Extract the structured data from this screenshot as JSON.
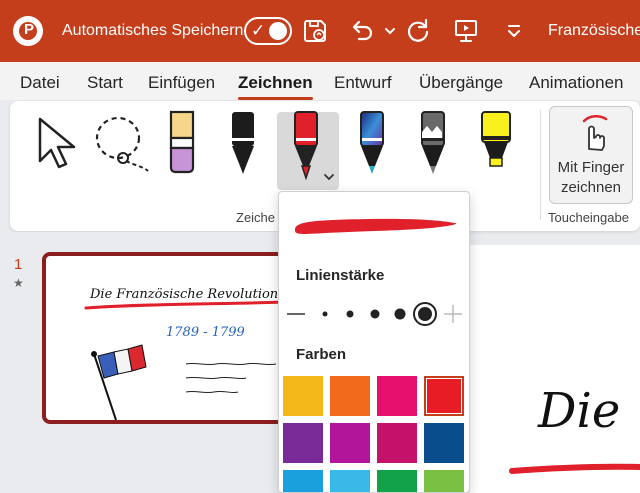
{
  "titlebar": {
    "app_logo_letter": "P",
    "autosave_label": "Automatisches Speichern",
    "autosave_on": true,
    "autosave_check": "✓",
    "document_title": "Französische",
    "icons": [
      "save-sync-icon",
      "undo-icon",
      "chevron-down-icon",
      "redo-icon",
      "present-icon",
      "customize-dropdown-icon"
    ]
  },
  "menu": {
    "tabs": [
      "Datei",
      "Start",
      "Einfügen",
      "Zeichnen",
      "Entwurf",
      "Übergänge",
      "Animationen"
    ],
    "active_tab": "Zeichnen"
  },
  "ribbon": {
    "tools": [
      "select-arrow-icon",
      "lasso-select-icon",
      "eraser-icon",
      "black-pen-icon",
      "red-pen-icon",
      "galaxy-pen-icon",
      "glitter-pen-icon",
      "highlighter-icon"
    ],
    "selected_tool": "red-pen-icon",
    "group_drawing_label": "Zeiche",
    "finger_button_line1": "Mit Finger",
    "finger_button_line2": "zeichnen",
    "group_touch_label": "Toucheingabe"
  },
  "dropdown": {
    "line_weight_heading": "Linienstärke",
    "colors_heading": "Farben",
    "pen_color": "#e0202a",
    "line_weights_count": 6,
    "selected_weight_index": 5,
    "colors": [
      "#f5b81a",
      "#f26b1d",
      "#e8106e",
      "#e81c24",
      "#7a2a97",
      "#b3159a",
      "#c4116a",
      "#0a4d8c",
      "#1aa0dc",
      "#39b9e8",
      "#12a24a",
      "#7ac143"
    ],
    "selected_color_index": 3
  },
  "slides": {
    "number": "1",
    "star": "★",
    "thumb_title": "Die Französische Revolution",
    "thumb_years": "1789 - 1799"
  },
  "canvas": {
    "title_text": "Die"
  }
}
